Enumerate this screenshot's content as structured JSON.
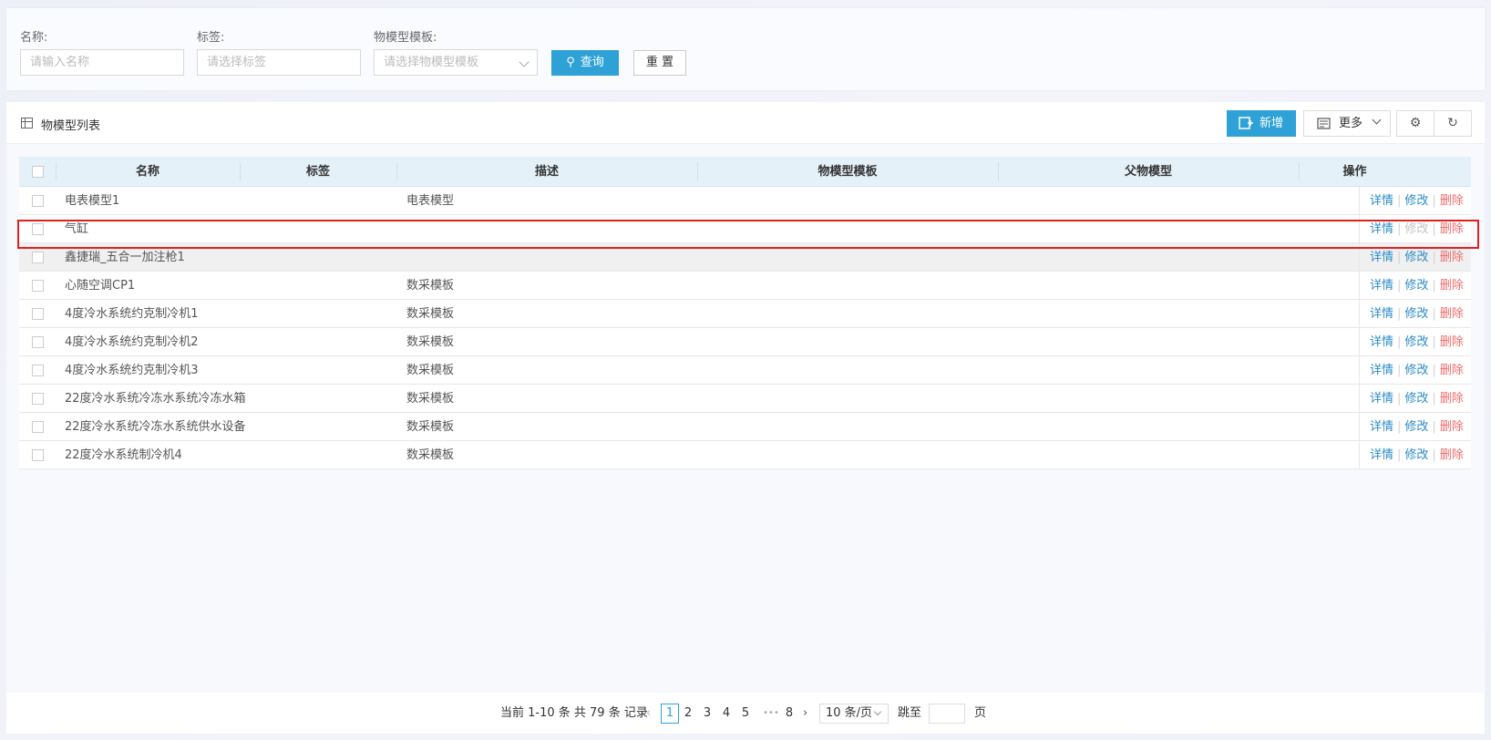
{
  "search": {
    "name_label": "名称:",
    "name_placeholder": "请输入名称",
    "tag_label": "标签:",
    "tag_placeholder": "请选择标签",
    "template_label": "物模型模板:",
    "template_placeholder": "请选择物模型模板",
    "query_label": "查询",
    "reset_label": "重 置"
  },
  "list": {
    "title": "物模型列表",
    "add_label": "新增",
    "more_label": "更多"
  },
  "table": {
    "headers": [
      "名称",
      "标签",
      "描述",
      "物模型模板",
      "父物模型",
      "操作"
    ],
    "rows": [
      {
        "name": "电表模型1",
        "tag": "",
        "desc": "电表模型",
        "template": "",
        "parent": ""
      },
      {
        "name": "气缸",
        "tag": "",
        "desc": "",
        "template": "",
        "parent": ""
      },
      {
        "name": "鑫捷瑞_五合一加注枪1",
        "tag": "",
        "desc": "",
        "template": "",
        "parent": ""
      },
      {
        "name": "心随空调CP1",
        "tag": "",
        "desc": "数采模板",
        "template": "",
        "parent": ""
      },
      {
        "name": "4度冷水系统约克制冷机1",
        "tag": "",
        "desc": "数采模板",
        "template": "",
        "parent": ""
      },
      {
        "name": "4度冷水系统约克制冷机2",
        "tag": "",
        "desc": "数采模板",
        "template": "",
        "parent": ""
      },
      {
        "name": "4度冷水系统约克制冷机3",
        "tag": "",
        "desc": "数采模板",
        "template": "",
        "parent": ""
      },
      {
        "name": "22度冷水系统冷冻水系统冷冻水箱",
        "tag": "",
        "desc": "数采模板",
        "template": "",
        "parent": ""
      },
      {
        "name": "22度冷水系统冷冻水系统供水设备",
        "tag": "",
        "desc": "数采模板",
        "template": "",
        "parent": ""
      },
      {
        "name": "22度冷水系统制冷机4",
        "tag": "",
        "desc": "数采模板",
        "template": "",
        "parent": ""
      }
    ],
    "ops": {
      "detail": "详情",
      "edit": "修改",
      "delete": "删除"
    }
  },
  "pagination": {
    "summary": "当前 1-10 条 共 79 条 记录",
    "pages": [
      "1",
      "2",
      "3",
      "4",
      "5",
      "•••",
      "8"
    ],
    "current": "1",
    "page_size": "10 条/页",
    "jump_label": "跳至",
    "page_suffix": "页"
  },
  "colors": {
    "accent": "#2ea1d6",
    "delete": "#f06a6a",
    "highlight": "#e02020"
  }
}
